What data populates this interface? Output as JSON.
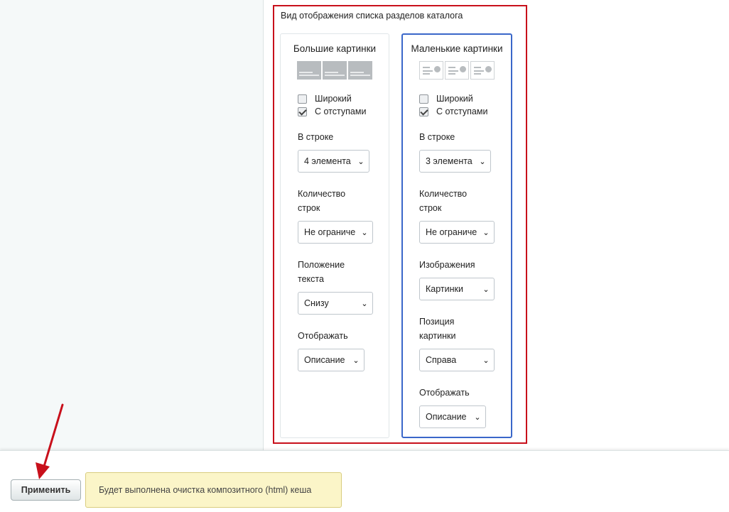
{
  "section": {
    "title": "Вид отображения списка разделов каталога"
  },
  "colors": {
    "highlight_frame": "#c8101b",
    "selected_card_border": "#3a67c9",
    "notice_bg": "#fbf5c8",
    "arrow": "#c8101b"
  },
  "cards": {
    "big": {
      "title": "Большие картинки",
      "icon": "large-image-grid-icon",
      "checkboxes": [
        {
          "label": "Широкий",
          "checked": false
        },
        {
          "label": "С отступами",
          "checked": true
        }
      ],
      "fields": {
        "per_row": {
          "label": "В строке",
          "value": "4 элемента"
        },
        "rows": {
          "label": "Количество строк",
          "value": "Не ограниче"
        },
        "text_position": {
          "label": "Положение текста",
          "value": "Снизу"
        },
        "display": {
          "label": "Отображать",
          "value": "Описание"
        }
      }
    },
    "small": {
      "title": "Маленькие картинки",
      "icon": "small-image-list-icon",
      "selected": true,
      "checkboxes": [
        {
          "label": "Широкий",
          "checked": false
        },
        {
          "label": "С отступами",
          "checked": true
        }
      ],
      "fields": {
        "per_row": {
          "label": "В строке",
          "value": "3 элемента"
        },
        "rows": {
          "label": "Количество строк",
          "value": "Не ограниче"
        },
        "images": {
          "label": "Изображения",
          "value": "Картинки"
        },
        "image_position": {
          "label": "Позиция картинки",
          "value": "Справа"
        },
        "display": {
          "label": "Отображать",
          "value": "Описание"
        }
      }
    }
  },
  "footer": {
    "apply_label": "Применить",
    "notice": "Будет выполнена очистка композитного (html) кеша"
  }
}
